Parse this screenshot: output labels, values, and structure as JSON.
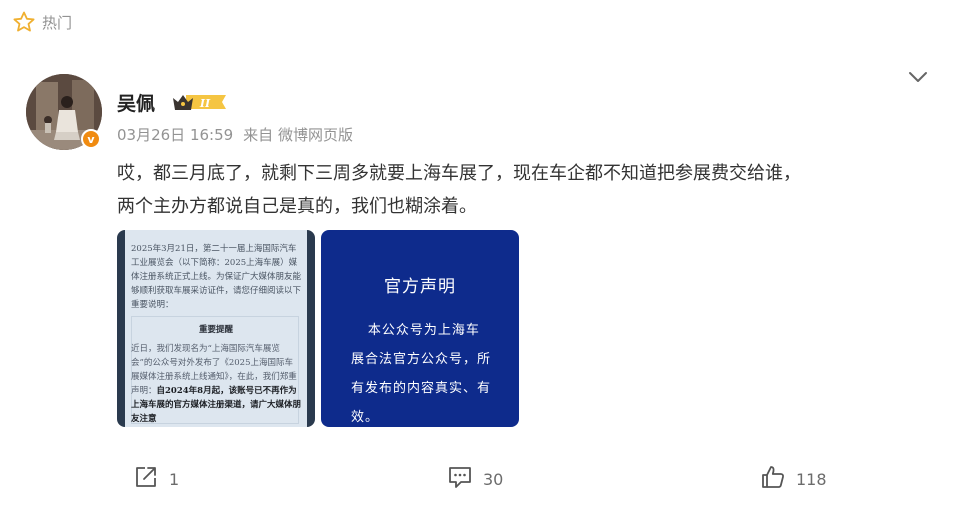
{
  "header": {
    "hot_label": "热门"
  },
  "post": {
    "author": {
      "name": "吴佩",
      "vip_level": "II",
      "verified_badge": "v"
    },
    "meta": {
      "time": "03月26日 16:59",
      "source": "来自 微博网页版"
    },
    "text_line1": "哎，都三月底了，就剩下三周多就要上海车展了，现在车企都不知道把参展费交给谁，",
    "text_line2": "两个主办方都说自己是真的，我们也糊涂着。",
    "images": {
      "doc": {
        "intro": "2025年3月21日，第二十一届上海国际汽车工业展览会（以下简称：2025上海车展）媒体注册系统正式上线。为保证广大媒体朋友能够顺利获取车展采访证件，请您仔细阅读以下重要说明：",
        "title": "重要提醒",
        "body_plain": "近日，我们发现名为“上海国际汽车展览会”的公众号对外发布了《2025上海国际车展媒体注册系统上线通知》，在此，我们郑重声明：",
        "body_bold": "自2024年8月起，该账号已不再作为上海车展的官方媒体注册渠道，请广大媒体朋友注意"
      },
      "statement": {
        "title": "官方声明",
        "body": "本公众号为上海车展合法官方公众号，所有发布的内容真实、有效。"
      }
    },
    "actions": {
      "repost_count": "1",
      "comment_count": "30",
      "like_count": "118"
    }
  },
  "colors": {
    "accent_orange": "#f08b11",
    "meta_gray": "#939393",
    "statement_blue": "#0e2b8c"
  }
}
